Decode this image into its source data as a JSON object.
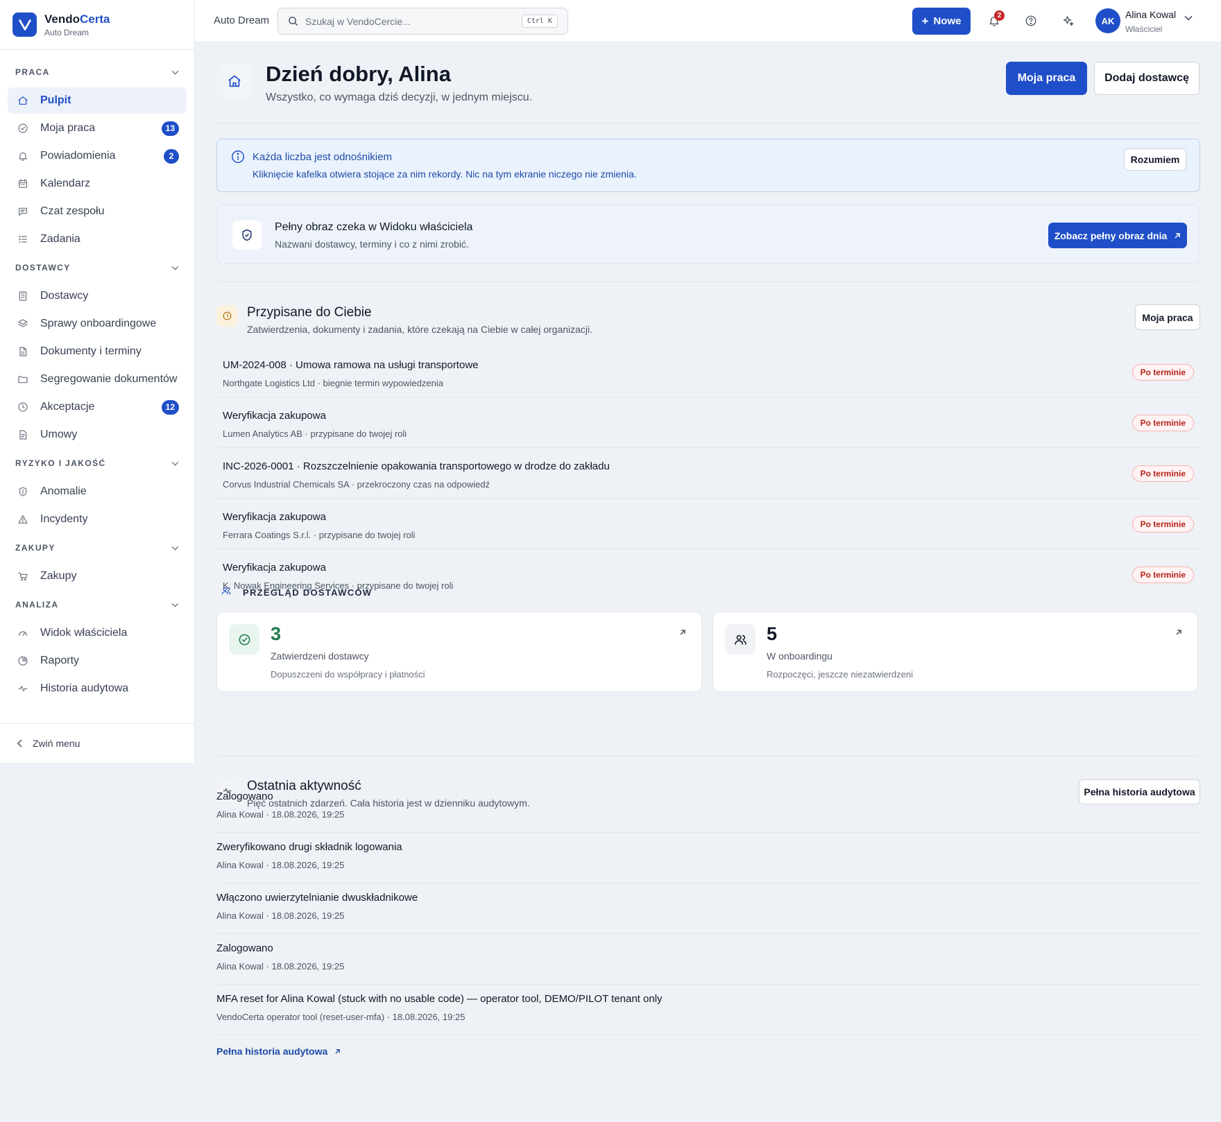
{
  "brand": {
    "name_main": "Vendo",
    "name_accent": "Certa",
    "org": "Auto Dream"
  },
  "sidebar": {
    "sections": [
      {
        "title": "PRACA",
        "items": [
          {
            "label": "Pulpit",
            "icon": "home-icon",
            "active": true
          },
          {
            "label": "Moja praca",
            "icon": "check-circle-icon",
            "badge": "13"
          },
          {
            "label": "Powiadomienia",
            "icon": "bell-icon",
            "badge": "2"
          },
          {
            "label": "Kalendarz",
            "icon": "calendar-icon"
          },
          {
            "label": "Czat zespołu",
            "icon": "chat-icon"
          },
          {
            "label": "Zadania",
            "icon": "list-check-icon"
          }
        ]
      },
      {
        "title": "DOSTAWCY",
        "items": [
          {
            "label": "Dostawcy",
            "icon": "building-icon"
          },
          {
            "label": "Sprawy onboardingowe",
            "icon": "layers-icon"
          },
          {
            "label": "Dokumenty i terminy",
            "icon": "file-icon"
          },
          {
            "label": "Segregowanie dokumentów",
            "icon": "folder-icon"
          },
          {
            "label": "Akceptacje",
            "icon": "clock-icon",
            "badge": "12"
          },
          {
            "label": "Umowy",
            "icon": "contract-icon"
          }
        ]
      },
      {
        "title": "RYZYKO I JAKOŚĆ",
        "items": [
          {
            "label": "Anomalie",
            "icon": "shield-icon"
          },
          {
            "label": "Incydenty",
            "icon": "warning-icon"
          }
        ]
      },
      {
        "title": "ZAKUPY",
        "items": [
          {
            "label": "Zakupy",
            "icon": "cart-icon"
          }
        ]
      },
      {
        "title": "ANALIZA",
        "items": [
          {
            "label": "Widok właściciela",
            "icon": "gauge-icon"
          },
          {
            "label": "Raporty",
            "icon": "pie-chart-icon"
          },
          {
            "label": "Historia audytowa",
            "icon": "activity-icon"
          }
        ]
      }
    ],
    "collapse_label": "Zwiń menu"
  },
  "topbar": {
    "org": "Auto Dream",
    "search_placeholder": "Szukaj w VendoCercie...",
    "shortcut": "Ctrl K",
    "new_label": "Nowe",
    "notif_count": "2",
    "user": {
      "initials": "AK",
      "name": "Alina Kowal",
      "role": "Właściciel"
    }
  },
  "header": {
    "title": "Dzień dobry, Alina",
    "subtitle": "Wszystko, co wymaga dziś decyzji, w jednym miejscu.",
    "primary_button": "Moja praca",
    "secondary_button": "Dodaj dostawcę"
  },
  "info": {
    "title": "Każda liczba jest odnośnikiem",
    "text": "Kliknięcie kafelka otwiera stojące za nim rekordy. Nic na tym ekranie niczego nie zmienia.",
    "button": "Rozumiem"
  },
  "owner": {
    "title": "Pełny obraz czeka w Widoku właściciela",
    "subtitle": "Nazwani dostawcy, terminy i co z nimi zrobić.",
    "button": "Zobacz pełny obraz dnia"
  },
  "assigned": {
    "title": "Przypisane do Ciebie",
    "subtitle": "Zatwierdzenia, dokumenty i zadania, które czekają na Ciebie w całej organizacji.",
    "button": "Moja praca",
    "items": [
      {
        "title": "UM-2024-008 · Umowa ramowa na usługi transportowe",
        "sub": "Northgate Logistics Ltd · biegnie termin wypowiedzenia",
        "status": "Po terminie"
      },
      {
        "title": "Weryfikacja zakupowa",
        "sub": "Lumen Analytics AB · przypisane do twojej roli",
        "status": "Po terminie"
      },
      {
        "title": "INC-2026-0001 · Rozszczelnienie opakowania transportowego w drodze do zakładu",
        "sub": "Corvus Industrial Chemicals SA · przekroczony czas na odpowiedź",
        "status": "Po terminie"
      },
      {
        "title": "Weryfikacja zakupowa",
        "sub": "Ferrara Coatings S.r.l. · przypisane do twojej roli",
        "status": "Po terminie"
      },
      {
        "title": "Weryfikacja zakupowa",
        "sub": "K. Nowak Engineering Services · przypisane do twojej roli",
        "status": "Po terminie"
      }
    ]
  },
  "overview": {
    "label": "PRZEGLĄD DOSTAWCÓW",
    "cards": [
      {
        "value": "3",
        "label": "Zatwierdzeni dostawcy",
        "sub": "Dopuszczeni do współpracy i płatności",
        "icon": "check-circle-icon",
        "accent": "#1f7a4d"
      },
      {
        "value": "5",
        "label": "W onboardingu",
        "sub": "Rozpoczęci, jeszcze niezatwierdzeni",
        "icon": "users-icon",
        "accent": "#111827"
      }
    ]
  },
  "activity": {
    "title": "Ostatnia aktywność",
    "subtitle": "Pięć ostatnich zdarzeń. Cała historia jest w dzienniku audytowym.",
    "button": "Pełna historia audytowa",
    "items": [
      {
        "title": "Zalogowano",
        "sub": "Alina Kowal · 18.08.2026, 19:25"
      },
      {
        "title": "Zweryfikowano drugi składnik logowania",
        "sub": "Alina Kowal · 18.08.2026, 19:25"
      },
      {
        "title": "Włączono uwierzytelnianie dwuskładnikowe",
        "sub": "Alina Kowal · 18.08.2026, 19:25"
      },
      {
        "title": "Zalogowano",
        "sub": "Alina Kowal · 18.08.2026, 19:25"
      },
      {
        "title": "MFA reset for Alina Kowal (stuck with no usable code) — operator tool, DEMO/PILOT tenant only",
        "sub": "VendoCerta operator tool (reset-user-mfa) · 18.08.2026, 19:25"
      }
    ],
    "link": "Pełna historia audytowa"
  },
  "colors": {
    "accent": "#1f4fc8",
    "danger": "#b42318",
    "success": "#1f7a4d"
  }
}
